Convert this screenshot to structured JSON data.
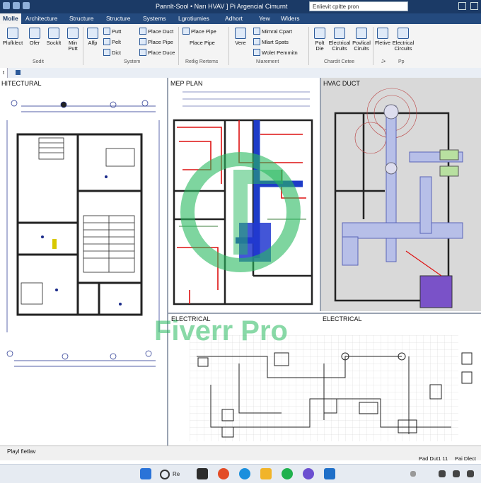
{
  "window": {
    "title": "Pannlt-Sool • Narı HVAV ] Pi Argencial Cimurnt",
    "search_placeholder": "Enlievit cpitte pron"
  },
  "tabs": [
    {
      "label": "Molle"
    },
    {
      "label": "Architecture"
    },
    {
      "label": "Structure"
    },
    {
      "label": "Structure"
    },
    {
      "label": "Systems"
    },
    {
      "label": "Lgrotiumies"
    },
    {
      "label": "Adhort"
    },
    {
      "label": "Yew"
    },
    {
      "label": "Wlders"
    }
  ],
  "ribbon": {
    "buttons": [
      {
        "label": "Plufklect",
        "icon": "mirror-icon"
      },
      {
        "label": "Ofer",
        "icon": "copy-icon"
      },
      {
        "label": "Socklt",
        "icon": "socket-icon"
      },
      {
        "label": "Min Putt",
        "icon": "pencil-icon"
      },
      {
        "label": "Alfp",
        "icon": "align-icon"
      }
    ],
    "small_buttons": [
      {
        "label": "Putt"
      },
      {
        "label": "Pelt"
      },
      {
        "label": "Dict"
      },
      {
        "label": "Place Duct"
      },
      {
        "label": "Place Pipe"
      },
      {
        "label": "Place Duce"
      },
      {
        "label": "Place Pipe"
      },
      {
        "label": "Place Pipe"
      },
      {
        "label": "Mimral Cpart"
      },
      {
        "label": "Mlart Spats"
      },
      {
        "label": "Wolet Pemmitn"
      }
    ],
    "buttons_right": [
      {
        "label": "Vere",
        "icon": "grid-icon"
      },
      {
        "label": "Polt Die",
        "icon": "panel-icon"
      },
      {
        "label": "Electrical Ciruits",
        "icon": "circuit-icon"
      },
      {
        "label": "Povlical Ciruits",
        "icon": "circuit-icon"
      },
      {
        "label": "Fletive",
        "icon": "chart-icon"
      },
      {
        "label": "Electrical Circuits",
        "icon": "circuit-icon"
      }
    ],
    "groups": [
      "Sodit",
      "System",
      "Retlig Rertems",
      "Niarement",
      "Chardit Cetee",
      "J•",
      "Pp"
    ]
  },
  "views": {
    "active_tab": "t",
    "architectural": "HITECTURAL",
    "mep": "MEP PLAN",
    "hvac": "HVAC DUCT",
    "electrical_left": "ELECTRICAL",
    "electrical_right": "ELECTRICAL"
  },
  "status": {
    "left": "Playl fietlav",
    "right": "Pad Dut1 11",
    "right2": "Pai Dlect"
  },
  "taskbar": {
    "search_label": "Re"
  },
  "watermark": {
    "text": "Fiverr Pro"
  }
}
